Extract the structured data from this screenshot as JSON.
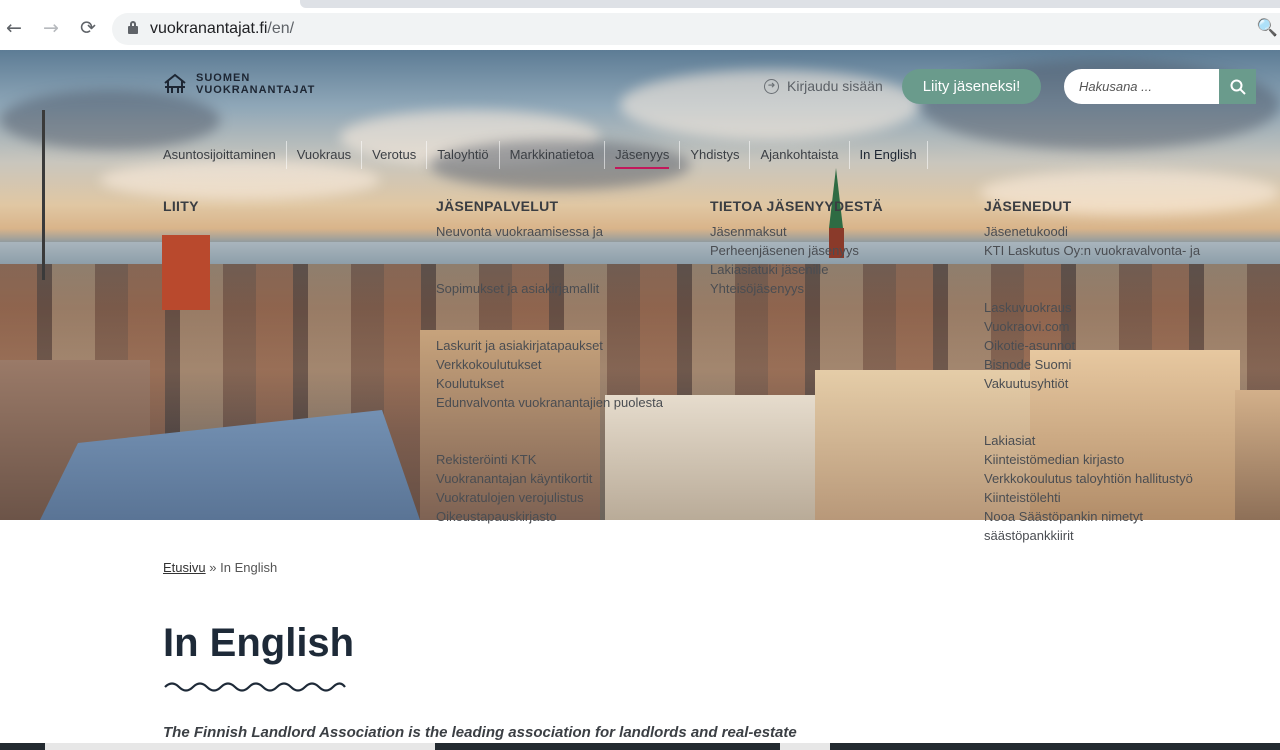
{
  "browser": {
    "url_domain": "vuokranantajat.fi",
    "url_path": "/en/",
    "back_icon": "arrow-left",
    "forward_icon": "arrow-right",
    "reload_icon": "reload",
    "zoom_icon": "magnifier"
  },
  "header": {
    "logo_line1": "SUOMEN",
    "logo_line2": "VUOKRANANTAJAT",
    "login_label": "Kirjaudu sisään",
    "join_label": "Liity jäseneksi!",
    "search_placeholder": "Hakusana ...",
    "accent_color": "#6a9b8c"
  },
  "nav": {
    "items": [
      {
        "label": "Asuntosijoittaminen"
      },
      {
        "label": "Vuokraus"
      },
      {
        "label": "Verotus"
      },
      {
        "label": "Taloyhtiö"
      },
      {
        "label": "Markkinatietoa"
      },
      {
        "label": "Jäsenyys"
      },
      {
        "label": "Yhdistys"
      },
      {
        "label": "Ajankohtaista"
      },
      {
        "label": "In English"
      }
    ],
    "active_underline_color": "#c2185b"
  },
  "mega_menu": {
    "col1": {
      "title": "LIITY",
      "links": []
    },
    "col2": {
      "title": "JÄSENPALVELUT",
      "links": [
        "Neuvonta vuokraamisessa ja",
        "",
        "",
        "Sopimukset ja asiakirjamallit",
        "",
        "",
        "Laskurit ja asiakirjatapaukset",
        "Verkkokoulutukset",
        "Koulutukset",
        "Edunvalvonta vuokranantajien puolesta",
        "",
        "",
        "Rekisteröinti KTK",
        "Vuokranantajan käyntikortit",
        "Vuokratulojen verojulistus",
        "Oikeustapauskirjasto"
      ]
    },
    "col3": {
      "title": "TIETOA JÄSENYYDESTÄ",
      "links": [
        "Jäsenmaksut",
        "Perheenjäsenen jäsenyys",
        "Lakiasiatuki jäsenille",
        "Yhteisöjäsenyys"
      ]
    },
    "col4": {
      "title": "JÄSENEDUT",
      "links": [
        "Jäsenetukoodi",
        "KTI Laskutus Oy:n vuokravalvonta- ja",
        "",
        "",
        "Laskuvuokraus",
        "Vuokraovi.com",
        "Oikotie-asunnot",
        "Bisnode Suomi",
        "Vakuutusyhtiöt",
        "",
        "",
        "Lakiasiat",
        "Kiinteistömedian kirjasto",
        "Verkkokoulutus taloyhtiön hallitustyö",
        "Kiinteistölehti",
        "Nooa Säästöpankin nimetyt",
        "säästöpankkiirit"
      ]
    }
  },
  "breadcrumb": {
    "home": "Etusivu",
    "separator": "»",
    "current": "In English"
  },
  "page": {
    "title": "In English",
    "lead": "The Finnish Landlord Association is the leading association for landlords and real-estate"
  }
}
